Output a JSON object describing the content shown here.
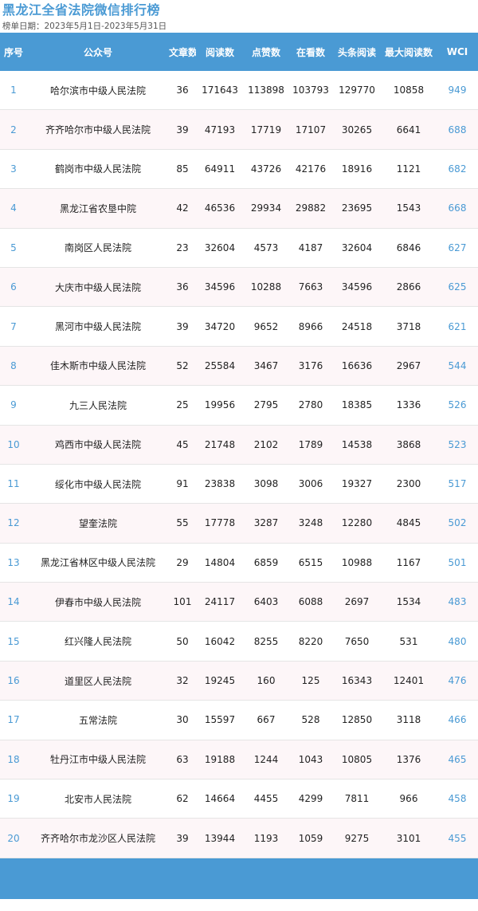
{
  "title": "黑龙江全省法院微信排行榜",
  "date_range": "榜单日期：2023年5月1日-2023年5月31日",
  "headers": [
    "序号",
    "公众号",
    "文章数",
    "阅读数",
    "点赞数",
    "在看数",
    "头条阅读",
    "最大阅读数",
    "WCI"
  ],
  "rows": [
    [
      "1",
      "哈尔滨市中级人民法院",
      "36",
      "171643",
      "113898",
      "103793",
      "129770",
      "10858",
      "949"
    ],
    [
      "2",
      "齐齐哈尔市中级人民法院",
      "39",
      "47193",
      "17719",
      "17107",
      "30265",
      "6641",
      "688"
    ],
    [
      "3",
      "鹤岗市中级人民法院",
      "85",
      "64911",
      "43726",
      "42176",
      "18916",
      "1121",
      "682"
    ],
    [
      "4",
      "黑龙江省农垦中院",
      "42",
      "46536",
      "29934",
      "29882",
      "23695",
      "1543",
      "668"
    ],
    [
      "5",
      "南岗区人民法院",
      "23",
      "32604",
      "4573",
      "4187",
      "32604",
      "6846",
      "627"
    ],
    [
      "6",
      "大庆市中级人民法院",
      "36",
      "34596",
      "10288",
      "7663",
      "34596",
      "2866",
      "625"
    ],
    [
      "7",
      "黑河市中级人民法院",
      "39",
      "34720",
      "9652",
      "8966",
      "24518",
      "3718",
      "621"
    ],
    [
      "8",
      "佳木斯市中级人民法院",
      "52",
      "25584",
      "3467",
      "3176",
      "16636",
      "2967",
      "544"
    ],
    [
      "9",
      "九三人民法院",
      "25",
      "19956",
      "2795",
      "2780",
      "18385",
      "1336",
      "526"
    ],
    [
      "10",
      "鸡西市中级人民法院",
      "45",
      "21748",
      "2102",
      "1789",
      "14538",
      "3868",
      "523"
    ],
    [
      "11",
      "绥化市中级人民法院",
      "91",
      "23838",
      "3098",
      "3006",
      "19327",
      "2300",
      "517"
    ],
    [
      "12",
      "望奎法院",
      "55",
      "17778",
      "3287",
      "3248",
      "12280",
      "4845",
      "502"
    ],
    [
      "13",
      "黑龙江省林区中级人民法院",
      "29",
      "14804",
      "6859",
      "6515",
      "10988",
      "1167",
      "501"
    ],
    [
      "14",
      "伊春市中级人民法院",
      "101",
      "24117",
      "6403",
      "6088",
      "2697",
      "1534",
      "483"
    ],
    [
      "15",
      "红兴隆人民法院",
      "50",
      "16042",
      "8255",
      "8220",
      "7650",
      "531",
      "480"
    ],
    [
      "16",
      "道里区人民法院",
      "32",
      "19245",
      "160",
      "125",
      "16343",
      "12401",
      "476"
    ],
    [
      "17",
      "五常法院",
      "30",
      "15597",
      "667",
      "528",
      "12850",
      "3118",
      "466"
    ],
    [
      "18",
      "牡丹江市中级人民法院",
      "63",
      "19188",
      "1244",
      "1043",
      "10805",
      "1376",
      "465"
    ],
    [
      "19",
      "北安市人民法院",
      "62",
      "14664",
      "4455",
      "4299",
      "7811",
      "966",
      "458"
    ],
    [
      "20",
      "齐齐哈尔市龙沙区人民法院",
      "39",
      "13944",
      "1193",
      "1059",
      "9275",
      "3101",
      "455"
    ]
  ]
}
